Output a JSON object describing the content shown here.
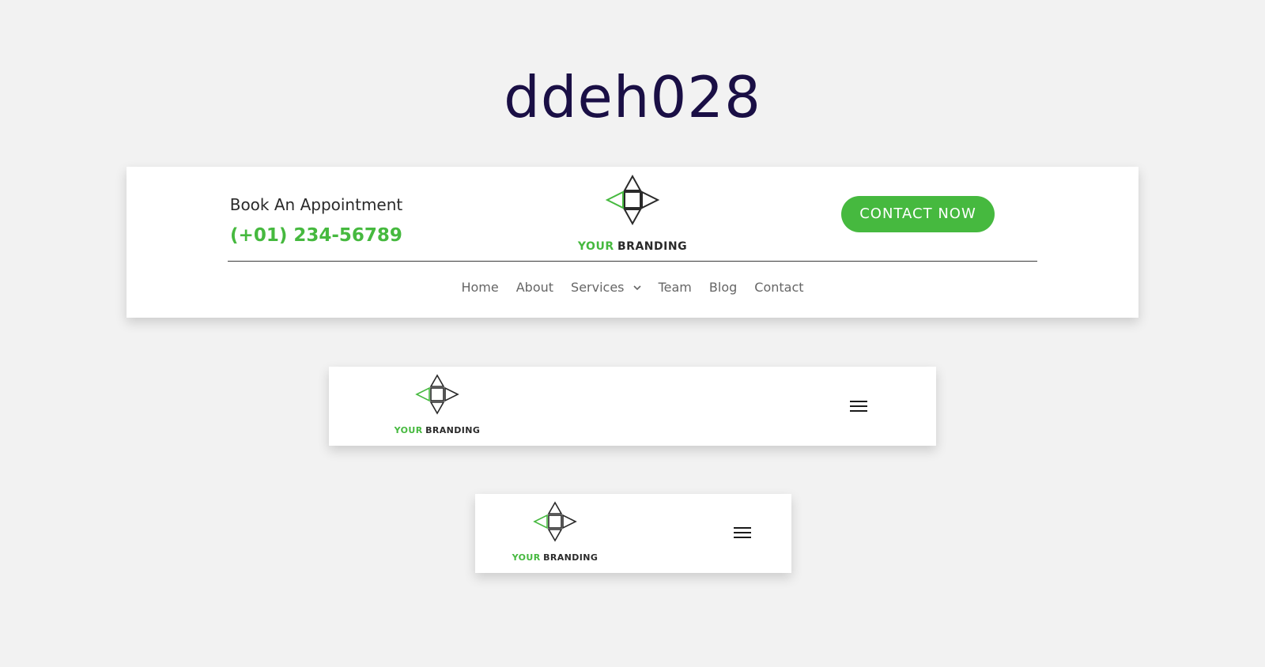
{
  "page": {
    "title": "ddeh028"
  },
  "brand": {
    "word_green": "YOUR",
    "word_dark": "BRANDING",
    "accent_color": "#46b93f",
    "dark_color": "#2a2a2a",
    "icon": "diamond-arrows-logo-icon"
  },
  "desktop_header": {
    "appointment_label": "Book An Appointment",
    "phone": "(+01) 234-56789",
    "cta_label": "CONTACT NOW",
    "nav": [
      {
        "label": "Home"
      },
      {
        "label": "About"
      },
      {
        "label": "Services"
      },
      {
        "label": "Team"
      },
      {
        "label": "Blog"
      },
      {
        "label": "Contact"
      }
    ]
  },
  "tablet_header": {
    "menu_icon": "hamburger-menu-icon"
  },
  "mobile_header": {
    "menu_icon": "hamburger-menu-icon"
  },
  "colors": {
    "background": "#f2f2f2",
    "title": "#1a0f45",
    "accent": "#46b93f",
    "nav_text": "#666666"
  }
}
